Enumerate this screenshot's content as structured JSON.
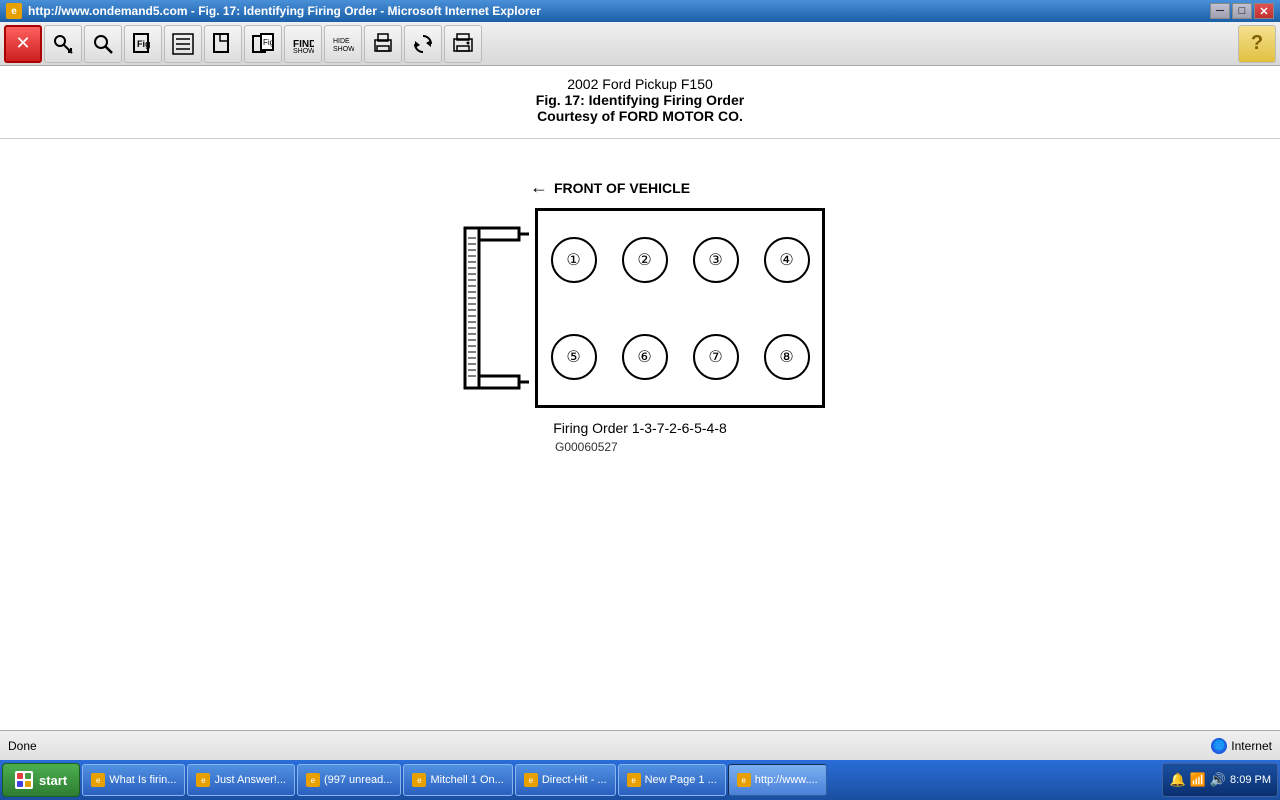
{
  "window": {
    "title": "http://www.ondemand5.com - Fig. 17: Identifying Firing Order - Microsoft Internet Explorer",
    "icon": "IE"
  },
  "toolbar": {
    "buttons": [
      {
        "id": "close",
        "icon": "✕",
        "label": "close"
      },
      {
        "id": "nav1",
        "icon": "🔑",
        "label": "key"
      },
      {
        "id": "nav2",
        "icon": "🔍",
        "label": "search"
      },
      {
        "id": "nav3",
        "icon": "📄",
        "label": "figure"
      },
      {
        "id": "nav4",
        "icon": "📋",
        "label": "list"
      },
      {
        "id": "nav5",
        "icon": "📃",
        "label": "page"
      },
      {
        "id": "nav6",
        "icon": "📄",
        "label": "fig2"
      },
      {
        "id": "nav7",
        "icon": "🔍",
        "label": "find"
      },
      {
        "id": "hide",
        "icon": "👁",
        "label": "hide-show"
      },
      {
        "id": "print1",
        "icon": "🖨",
        "label": "print1"
      },
      {
        "id": "refresh",
        "icon": "🔄",
        "label": "refresh"
      },
      {
        "id": "print2",
        "icon": "🖨",
        "label": "print2"
      }
    ],
    "help_label": "?"
  },
  "page": {
    "title_line1": "2002 Ford Pickup F150",
    "title_line2": "Fig. 17: Identifying Firing Order",
    "title_line3": "Courtesy of FORD MOTOR CO."
  },
  "diagram": {
    "front_label": "FRONT OF VEHICLE",
    "top_cylinders": [
      "1",
      "2",
      "3",
      "4"
    ],
    "bottom_cylinders": [
      "5",
      "6",
      "7",
      "8"
    ],
    "firing_order_label": "Firing Order 1-3-7-2-6-5-4-8",
    "part_number": "G00060527"
  },
  "status": {
    "text": "Done",
    "zone": "Internet"
  },
  "taskbar": {
    "start_label": "start",
    "time": "8:09 PM",
    "items": [
      {
        "label": "What Is firin...",
        "active": false
      },
      {
        "label": "Just Answer!...",
        "active": false
      },
      {
        "label": "(997 unread...",
        "active": false
      },
      {
        "label": "Mitchell 1 On...",
        "active": false
      },
      {
        "label": "Direct-Hit - ...",
        "active": false
      },
      {
        "label": "New Page 1 ...",
        "active": false
      },
      {
        "label": "http://www....",
        "active": true
      }
    ]
  }
}
